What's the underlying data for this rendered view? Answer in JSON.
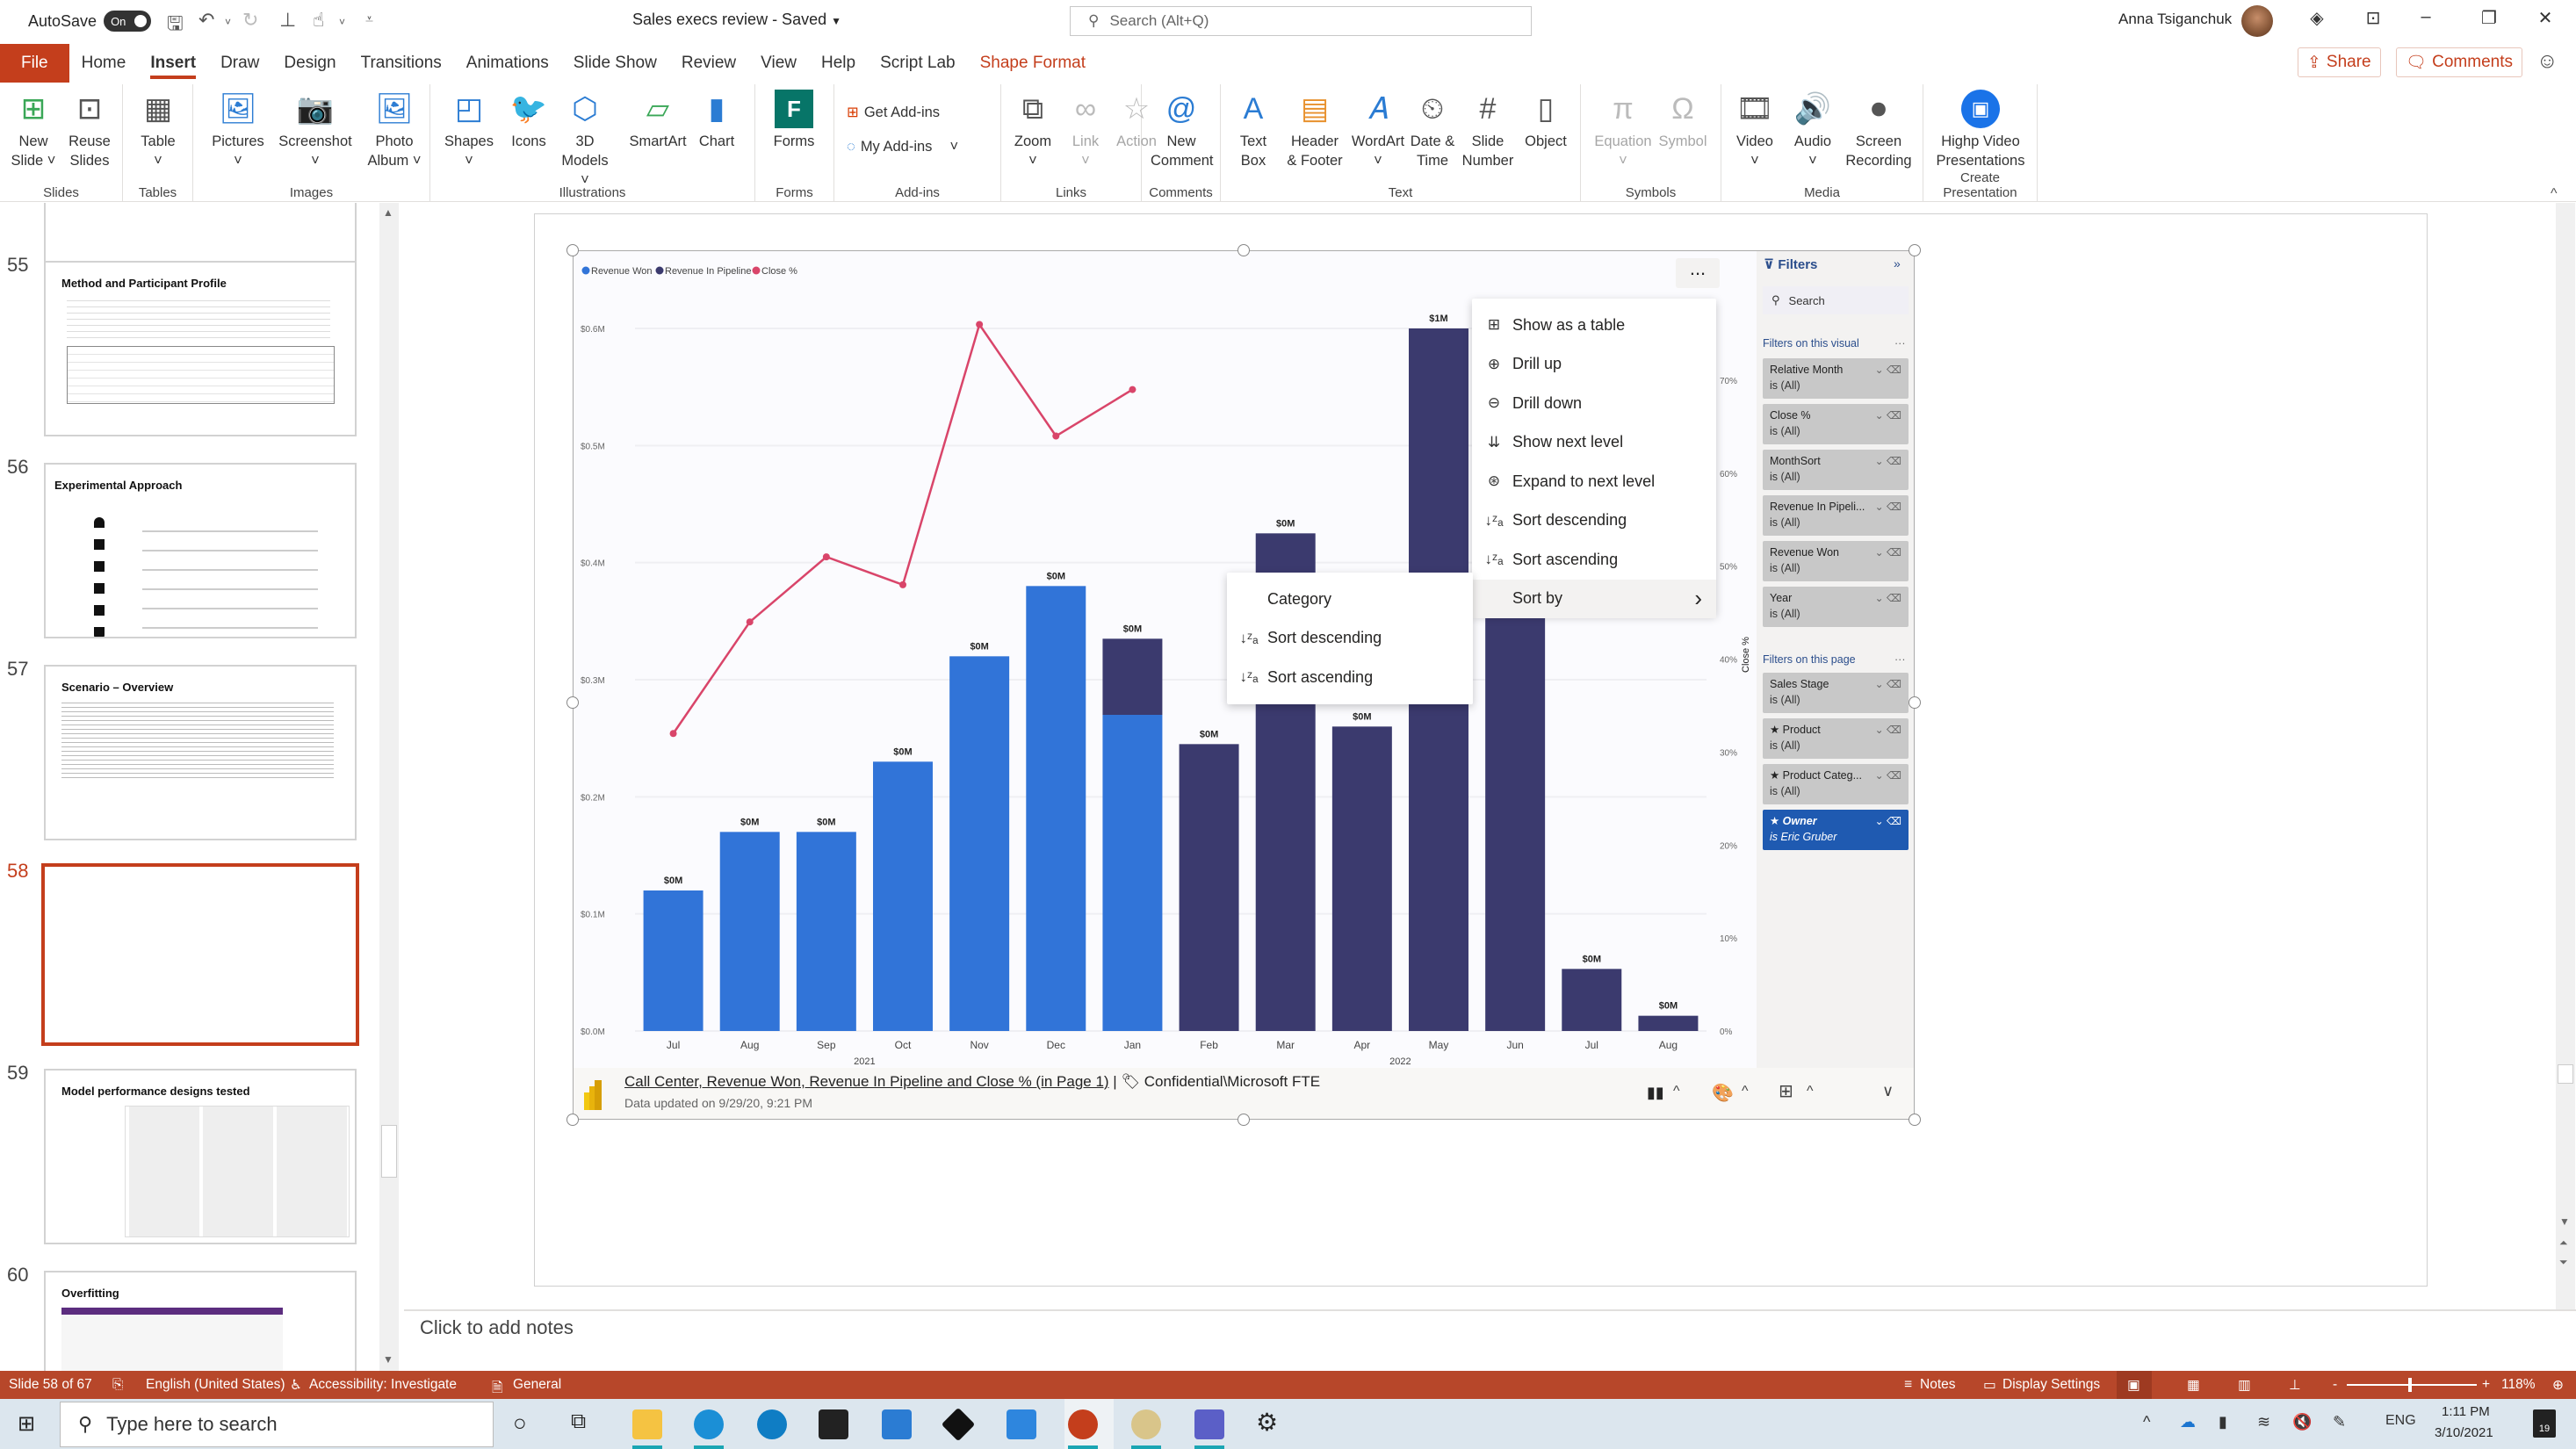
{
  "titlebar": {
    "autosave_label": "AutoSave",
    "autosave_state": "On",
    "doc_title": "Sales execs review  -  Saved",
    "search_placeholder": "Search (Alt+Q)",
    "user_name": "Anna Tsiganchuk"
  },
  "tabs": [
    "File",
    "Home",
    "Insert",
    "Draw",
    "Design",
    "Transitions",
    "Animations",
    "Slide Show",
    "Review",
    "View",
    "Help",
    "Script Lab",
    "Shape Format"
  ],
  "active_tab": "Insert",
  "share_label": "Share",
  "comments_label": "Comments",
  "ribbon": {
    "groups": [
      {
        "label": "Slides",
        "buttons": [
          {
            "l1": "New",
            "l2": "Slide ˅",
            "icon": "new-slide-icon"
          },
          {
            "l1": "Reuse",
            "l2": "Slides",
            "icon": "reuse-slides-icon"
          }
        ]
      },
      {
        "label": "Tables",
        "buttons": [
          {
            "l1": "Table",
            "l2": "˅",
            "icon": "table-icon"
          }
        ]
      },
      {
        "label": "Images",
        "buttons": [
          {
            "l1": "Pictures",
            "l2": "˅",
            "icon": "pictures-icon"
          },
          {
            "l1": "Screenshot",
            "l2": "˅",
            "icon": "screenshot-icon"
          },
          {
            "l1": "Photo",
            "l2": "Album ˅",
            "icon": "photo-album-icon"
          }
        ]
      },
      {
        "label": "Illustrations",
        "buttons": [
          {
            "l1": "Shapes",
            "l2": "˅",
            "icon": "shapes-icon"
          },
          {
            "l1": "Icons",
            "l2": "",
            "icon": "icons-icon"
          },
          {
            "l1": "3D",
            "l2": "Models ˅",
            "icon": "3d-models-icon"
          },
          {
            "l1": "SmartArt",
            "l2": "",
            "icon": "smartart-icon"
          },
          {
            "l1": "Chart",
            "l2": "",
            "icon": "chart-icon"
          }
        ]
      },
      {
        "label": "Forms",
        "buttons": [
          {
            "l1": "Forms",
            "l2": "",
            "icon": "forms-icon"
          }
        ]
      },
      {
        "label": "Add-ins",
        "buttons": [
          {
            "l1": "Get Add-ins",
            "l2": "",
            "icon": "get-addins-icon"
          },
          {
            "l1": "My Add-ins",
            "l2": "˅",
            "icon": "my-addins-icon"
          }
        ]
      },
      {
        "label": "Links",
        "buttons": [
          {
            "l1": "Zoom",
            "l2": "˅",
            "icon": "zoom-icon"
          },
          {
            "l1": "Link",
            "l2": "˅",
            "icon": "link-icon",
            "disabled": true
          },
          {
            "l1": "Action",
            "l2": "",
            "icon": "action-icon",
            "disabled": true
          }
        ]
      },
      {
        "label": "Comments",
        "buttons": [
          {
            "l1": "New",
            "l2": "Comment",
            "icon": "new-comment-icon"
          }
        ]
      },
      {
        "label": "Text",
        "buttons": [
          {
            "l1": "Text",
            "l2": "Box",
            "icon": "text-box-icon"
          },
          {
            "l1": "Header",
            "l2": "& Footer",
            "icon": "header-footer-icon"
          },
          {
            "l1": "WordArt",
            "l2": "˅",
            "icon": "wordart-icon"
          },
          {
            "l1": "Date &",
            "l2": "Time",
            "icon": "date-time-icon"
          },
          {
            "l1": "Slide",
            "l2": "Number",
            "icon": "slide-number-icon"
          },
          {
            "l1": "Object",
            "l2": "",
            "icon": "object-icon"
          }
        ]
      },
      {
        "label": "Symbols",
        "buttons": [
          {
            "l1": "Equation",
            "l2": "˅",
            "icon": "equation-icon",
            "disabled": true
          },
          {
            "l1": "Symbol",
            "l2": "",
            "icon": "symbol-icon",
            "disabled": true
          }
        ]
      },
      {
        "label": "Media",
        "buttons": [
          {
            "l1": "Video",
            "l2": "˅",
            "icon": "video-icon"
          },
          {
            "l1": "Audio",
            "l2": "˅",
            "icon": "audio-icon"
          },
          {
            "l1": "Screen",
            "l2": "Recording",
            "icon": "screen-recording-icon"
          }
        ]
      },
      {
        "label": "Create Presentation",
        "buttons": [
          {
            "l1": "Highp Video",
            "l2": "Presentations",
            "icon": "highp-video-icon"
          }
        ]
      }
    ]
  },
  "slides": [
    {
      "num": "55",
      "title": "Method and Participant Profile"
    },
    {
      "num": "56",
      "title": "Experimental Approach"
    },
    {
      "num": "57",
      "title": "Scenario – Overview"
    },
    {
      "num": "58",
      "title": ""
    },
    {
      "num": "59",
      "title": "Model performance designs tested"
    },
    {
      "num": "60",
      "title": "Overfitting"
    }
  ],
  "current_slide": "58",
  "notes_placeholder": "Click to add notes",
  "visual": {
    "more_options": "...",
    "footer_title": "Call Center, Revenue Won, Revenue In Pipeline and Close % (in Page 1)",
    "footer_sep": "|",
    "footer_label": "Confidential\\Microsoft FTE",
    "footer_updated": "Data updated on 9/29/20, 9:21 PM"
  },
  "context_menu": {
    "items": [
      {
        "label": "Show as a table",
        "icon": "table-view-icon"
      },
      {
        "label": "Drill up",
        "icon": "drill-up-icon"
      },
      {
        "label": "Drill down",
        "icon": "drill-down-icon"
      },
      {
        "label": "Show next level",
        "icon": "show-next-level-icon"
      },
      {
        "label": "Expand to next level",
        "icon": "expand-next-level-icon"
      },
      {
        "label": "Sort descending",
        "icon": "sort-descending-icon"
      },
      {
        "label": "Sort ascending",
        "icon": "sort-ascending-icon"
      },
      {
        "label": "Sort by",
        "icon": "",
        "submenu": true
      }
    ],
    "submenu": [
      {
        "label": "Category",
        "icon": ""
      },
      {
        "label": "Sort descending",
        "icon": "sort-descending-icon"
      },
      {
        "label": "Sort ascending",
        "icon": "sort-ascending-icon"
      }
    ]
  },
  "filters": {
    "title": "Filters",
    "search_placeholder": "Search",
    "visual_header": "Filters on this visual",
    "visual_filters": [
      {
        "name": "Relative Month",
        "value": "is (All)"
      },
      {
        "name": "Close %",
        "value": "is (All)"
      },
      {
        "name": "MonthSort",
        "value": "is (All)"
      },
      {
        "name": "Revenue In Pipeli...",
        "value": "is (All)"
      },
      {
        "name": "Revenue Won",
        "value": "is (All)"
      },
      {
        "name": "Year",
        "value": "is (All)"
      }
    ],
    "page_header": "Filters on this page",
    "page_filters": [
      {
        "name": "Sales Stage",
        "value": "is (All)",
        "active": false
      },
      {
        "name": "★ Product",
        "value": "is (All)",
        "active": false
      },
      {
        "name": "★ Product Categ...",
        "value": "is (All)",
        "active": false
      },
      {
        "name": "★ Owner",
        "value": "is Eric Gruber",
        "active": true
      }
    ]
  },
  "chart_data": {
    "type": "bar",
    "subtype": "stacked column + line (dual axis)",
    "title": "",
    "legend": [
      "Revenue Won",
      "Revenue In Pipeline",
      "Close %"
    ],
    "legend_position": "top-left",
    "colors": {
      "Revenue Won": "#3174d8",
      "Revenue In Pipeline": "#3b3a6e",
      "Close %": "#d9456a"
    },
    "categories": [
      "Jul",
      "Aug",
      "Sep",
      "Oct",
      "Nov",
      "Dec",
      "Jan",
      "Feb",
      "Mar",
      "Apr",
      "May",
      "Jun",
      "Jul",
      "Aug"
    ],
    "year_groups": [
      {
        "label": "2021",
        "from": 0,
        "to": 5
      },
      {
        "label": "2022",
        "from": 6,
        "to": 13
      }
    ],
    "series": [
      {
        "name": "Revenue Won",
        "axis": "left",
        "values": [
          0.12,
          0.17,
          0.17,
          0.23,
          0.32,
          0.38,
          0.27,
          0,
          0,
          0,
          0,
          0,
          0,
          0
        ]
      },
      {
        "name": "Revenue In Pipeline",
        "axis": "left",
        "values": [
          0,
          0,
          0,
          0,
          0,
          0,
          0.065,
          0.245,
          0.425,
          0.26,
          0.6,
          0.47,
          0.053,
          0.013
        ]
      },
      {
        "name": "Close %",
        "axis": "right",
        "type": "line",
        "values": [
          32,
          44,
          51,
          48,
          76,
          64,
          69,
          null,
          null,
          null,
          null,
          null,
          null,
          null
        ]
      }
    ],
    "data_labels": [
      "$0M",
      "$0M",
      "$0M",
      "$0M",
      "$0M",
      "$0M",
      "$0M",
      "$0M",
      "$0M",
      "$0M",
      "$1M",
      "",
      "$0M",
      "$0M"
    ],
    "ylabel": "",
    "y_ticks": [
      "$0.0M",
      "$0.1M",
      "$0.2M",
      "$0.3M",
      "$0.4M",
      "$0.5M",
      "$0.6M"
    ],
    "ylim": [
      0,
      0.6
    ],
    "y2label": "Close %",
    "y2_ticks": [
      "0%",
      "10%",
      "20%",
      "30%",
      "40%",
      "50%",
      "60%",
      "70%"
    ],
    "y2lim": [
      0,
      70
    ],
    "grid": true
  },
  "statusbar": {
    "slide_info": "Slide 58 of 67",
    "language": "English (United States)",
    "accessibility": "Accessibility: Investigate",
    "sensitivity": "General",
    "notes": "Notes",
    "display_settings": "Display Settings",
    "zoom": "118%"
  },
  "taskbar": {
    "search_placeholder": "Type here to search",
    "time": "1:11 PM",
    "date": "3/10/2021",
    "lang": "ENG",
    "notifications": "19"
  }
}
